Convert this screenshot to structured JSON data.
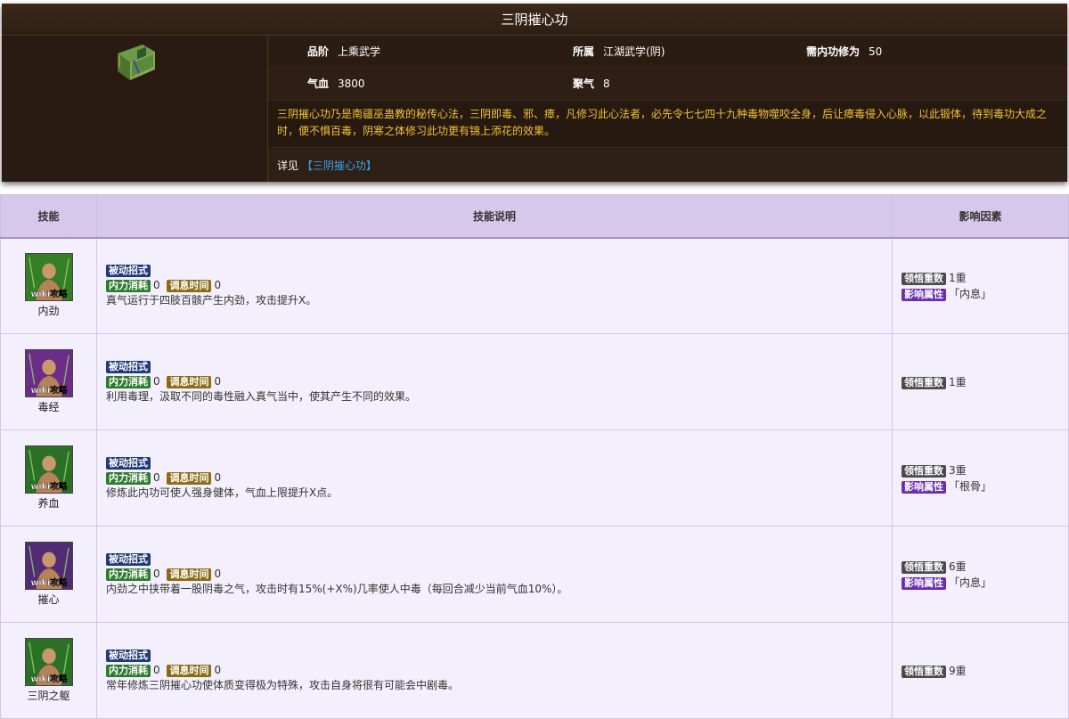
{
  "card": {
    "title": "三阴摧心功",
    "grade_label": "品阶",
    "grade_value": "上乘武学",
    "belong_label": "所属",
    "belong_value": "江湖武学(阴)",
    "req_label": "需内功修为",
    "req_value": "50",
    "hp_label": "气血",
    "hp_value": "3800",
    "focus_label": "聚气",
    "focus_value": "8",
    "description": "三阴摧心功乃是南疆巫蛊教的秘传心法，三阴即毒、邪、瘴，凡修习此心法者，必先令七七四十九种毒物噬咬全身，后让瘴毒侵入心脉，以此锻体，待到毒功大成之时，便不惧百毒，阴寒之体修习此功更有锦上添花的效果。",
    "detail_label": "详见",
    "detail_link": "【三阴摧心功】",
    "book_icon": "green-book-icon"
  },
  "table": {
    "headers": {
      "skill": "技能",
      "desc": "技能说明",
      "factor": "影响因素"
    },
    "tags": {
      "passive": "被动招式",
      "cost": "内力消耗",
      "cooldown": "调息时间",
      "level": "领悟重数",
      "attr": "影响属性"
    },
    "rows": [
      {
        "name": "内劲",
        "cost": "0",
        "cooldown": "0",
        "text": "真气运行于四肢百骸产生内劲，攻击提升X。",
        "level": "1重",
        "attr": "「内息」",
        "icon_color": "#3b8a2a",
        "watermark": "wiki攻略"
      },
      {
        "name": "毒经",
        "cost": "0",
        "cooldown": "0",
        "text": "利用毒理，汲取不同的毒性融入真气当中，使其产生不同的效果。",
        "level": "1重",
        "attr": "",
        "icon_color": "#7a2c9c",
        "watermark": "wiki攻略"
      },
      {
        "name": "养血",
        "cost": "0",
        "cooldown": "0",
        "text": "修炼此内功可使人强身健体，气血上限提升X点。",
        "level": "3重",
        "attr": "「根骨」",
        "icon_color": "#2f7a2a",
        "watermark": "wiki攻略"
      },
      {
        "name": "摧心",
        "cost": "0",
        "cooldown": "0",
        "text": "内劲之中挟带着一股阴毒之气，攻击时有15%(+X%)几率使人中毒（每回合减少当前气血10%）。",
        "level": "6重",
        "attr": "「内息」",
        "icon_color": "#5a2a86",
        "watermark": "wiki攻略"
      },
      {
        "name": "三阴之躯",
        "cost": "0",
        "cooldown": "0",
        "text": "常年修炼三阴摧心功使体质变得极为特殊，攻击自身将很有可能会中剧毒。",
        "level": "9重",
        "attr": "",
        "icon_color": "#2e7a2a",
        "watermark": "wiki攻略"
      }
    ]
  }
}
